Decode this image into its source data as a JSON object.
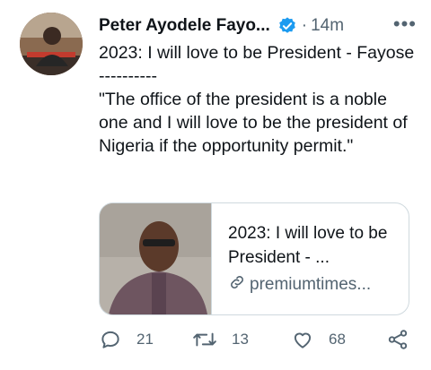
{
  "tweet": {
    "author_name": "Peter Ayodele Fayo...",
    "separator": "·",
    "time": "14m",
    "more_label": "•••",
    "lines": [
      "2023: I will love to be President - Fayose",
      "----------",
      "\"The office of the president is a noble one and I will love to be the president of Nigeria if the opportunity permit.\""
    ]
  },
  "card": {
    "title": "2023: I will love to be President - ...",
    "domain": "premiumtimes..."
  },
  "actions": {
    "replies": "21",
    "retweets": "13",
    "likes": "68"
  },
  "colors": {
    "verified": "#1d9bf0",
    "muted": "#536471",
    "border": "#cfd9de"
  }
}
